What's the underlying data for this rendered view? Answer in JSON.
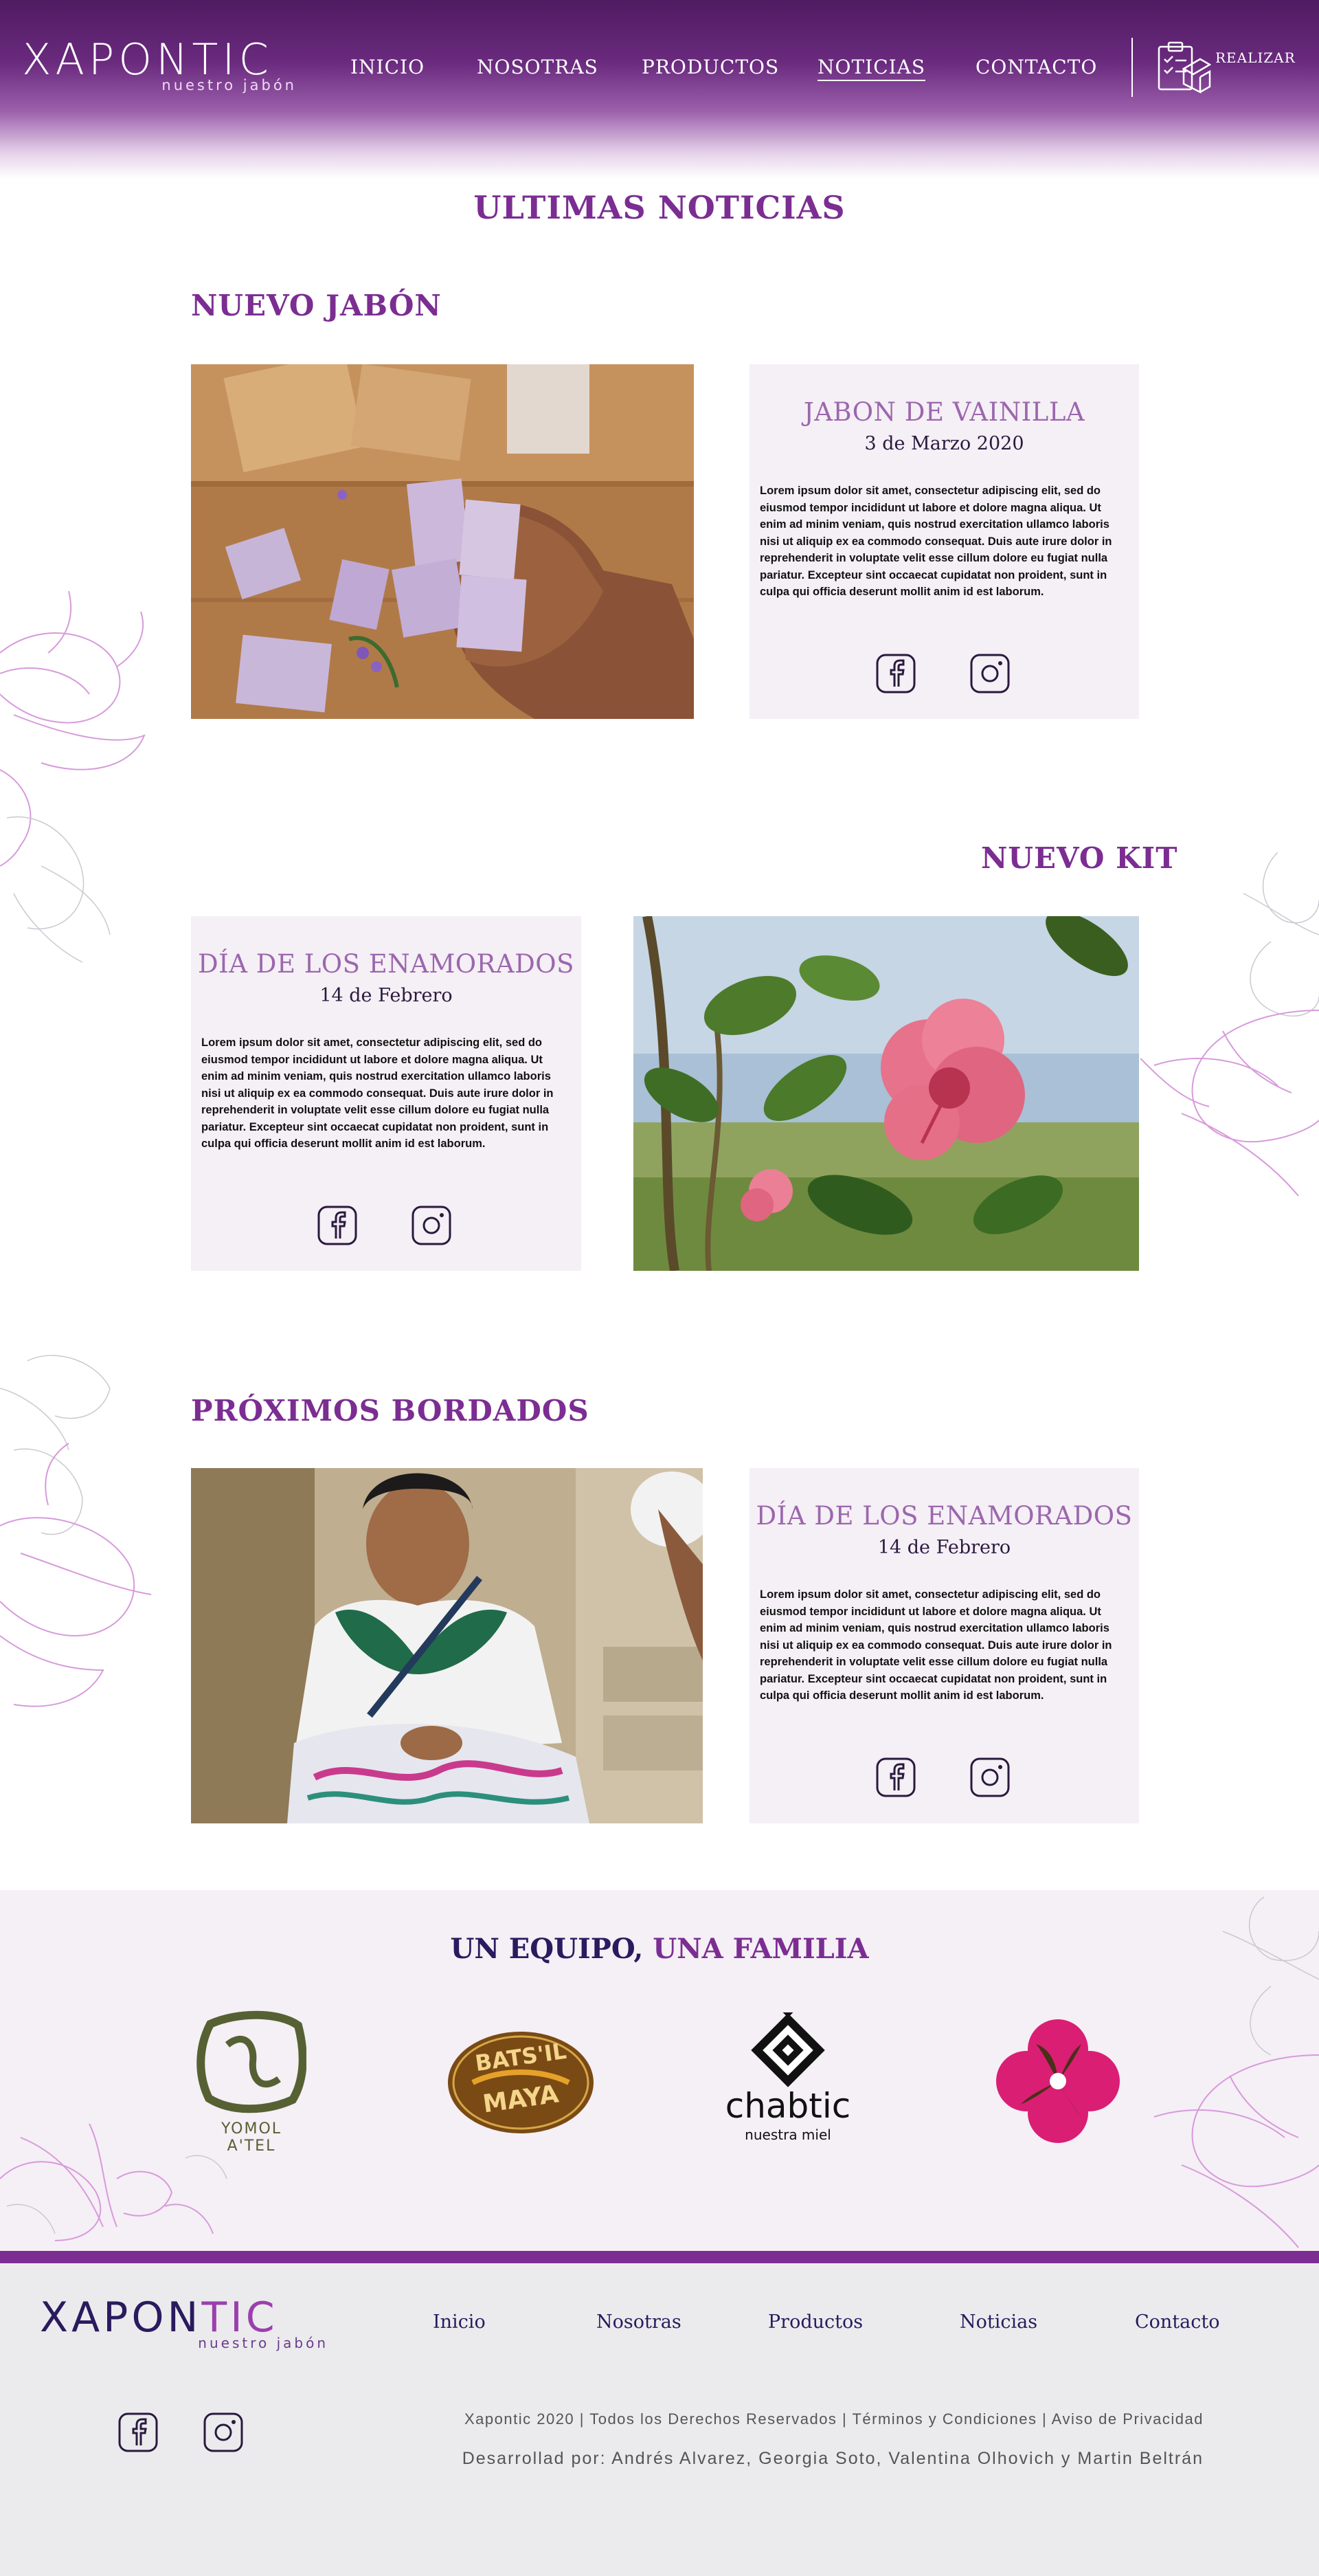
{
  "header": {
    "logo_text": "XAPONTIC",
    "logo_tagline": "nuestro jabón",
    "nav": [
      {
        "label": "INICIO",
        "active": false
      },
      {
        "label": "NOSOTRAS",
        "active": false
      },
      {
        "label": "PRODUCTOS",
        "active": false
      },
      {
        "label": "NOTICIAS",
        "active": true
      },
      {
        "label": "CONTACTO",
        "active": false
      }
    ],
    "order_label": "REALIZAR"
  },
  "page_title": "ULTIMAS NOTICIAS",
  "sections": [
    {
      "heading": "NUEVO JABÓN",
      "card": {
        "title": "JABON DE VAINILLA",
        "date": "3 de Marzo 2020",
        "body": "Lorem ipsum dolor sit amet, consectetur adipiscing elit, sed do eiusmod tempor incididunt ut labore et dolore magna aliqua. Ut enim ad minim veniam, quis nostrud exercitation ullamco laboris nisi ut aliquip ex ea commodo consequat. Duis aute irure dolor in reprehenderit in voluptate velit esse cillum dolore eu fugiat nulla pariatur. Excepteur sint occaecat cupidatat non proident, sunt in culpa qui officia deserunt mollit anim id est laborum."
      }
    },
    {
      "heading": "NUEVO KIT",
      "card": {
        "title": "DÍA DE LOS ENAMORADOS",
        "date": "14 de Febrero",
        "body": "Lorem ipsum dolor sit amet, consectetur adipiscing elit, sed do eiusmod tempor incididunt ut labore et dolore magna aliqua. Ut enim ad minim veniam, quis nostrud exercitation ullamco laboris nisi ut aliquip ex ea commodo consequat. Duis aute irure dolor in reprehenderit in voluptate velit esse cillum dolore eu fugiat nulla pariatur. Excepteur sint occaecat cupidatat non proident, sunt in culpa qui officia deserunt mollit anim id est laborum."
      }
    },
    {
      "heading": "PRÓXIMOS BORDADOS",
      "card": {
        "title": "DÍA DE LOS ENAMORADOS",
        "date": "14 de Febrero",
        "body": "Lorem ipsum dolor sit amet, consectetur adipiscing elit, sed do eiusmod tempor incididunt ut labore et dolore magna aliqua. Ut enim ad minim veniam, quis nostrud exercitation ullamco laboris nisi ut aliquip ex ea commodo consequat. Duis aute irure dolor in reprehenderit in voluptate velit esse cillum dolore eu fugiat nulla pariatur. Excepteur sint occaecat cupidatat non proident, sunt in culpa qui officia deserunt mollit anim id est laborum."
      }
    }
  ],
  "team": {
    "title_part1": "UN EQUIPO,",
    "title_part2": "UNA FAMILIA",
    "partners": [
      {
        "name": "YOMOL A'TEL"
      },
      {
        "name_line1": "BATS'IL",
        "name_line2": "MAYA"
      },
      {
        "name": "chabtic",
        "tagline": "nuestra miel"
      },
      {
        "icon": "pink-flower-icon"
      }
    ]
  },
  "footer": {
    "logo_text_part1": "XAPON",
    "logo_text_part2": "TIC",
    "logo_tagline": "nuestro jabón",
    "nav": [
      "Inicio",
      "Nosotras",
      "Productos",
      "Noticias",
      "Contacto"
    ],
    "copyright": "Xapontic 2020 | Todos los Derechos Reservados | Términos y Condiciones | Aviso de Privacidad",
    "developers": "Desarrollad por: Andrés Alvarez, Georgia Soto, Valentina Olhovich y Martin Beltrán"
  },
  "colors": {
    "brand_purple": "#7b2d92",
    "header_dark": "#4f1b61",
    "card_bg": "#f5eff6",
    "footer_bg": "#ebebed"
  }
}
